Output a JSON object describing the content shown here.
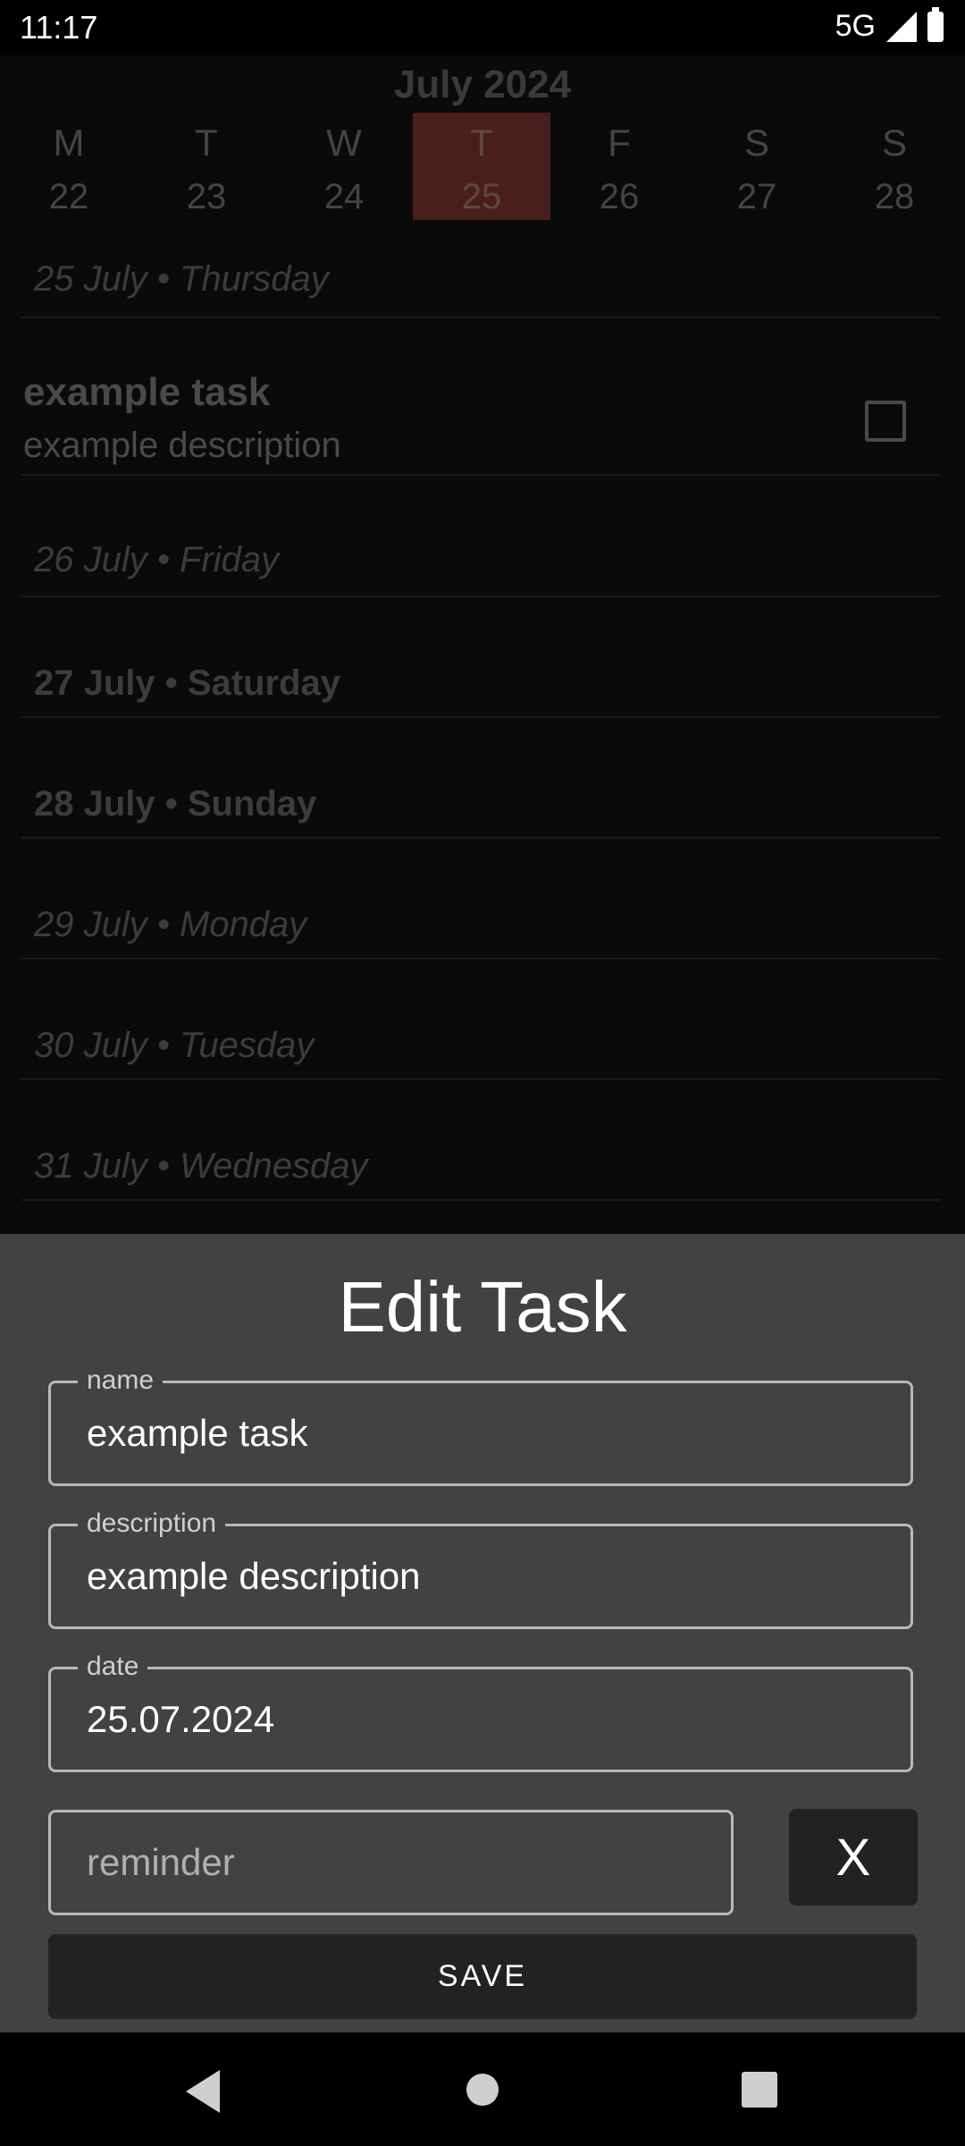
{
  "status_bar": {
    "time": "11:17",
    "network": "5G"
  },
  "calendar": {
    "month": "July 2024",
    "days": [
      {
        "name": "M",
        "num": "22"
      },
      {
        "name": "T",
        "num": "23"
      },
      {
        "name": "W",
        "num": "24"
      },
      {
        "name": "T",
        "num": "25"
      },
      {
        "name": "F",
        "num": "26"
      },
      {
        "name": "S",
        "num": "27"
      },
      {
        "name": "S",
        "num": "28"
      }
    ],
    "selected_index": 3,
    "selected_color": "#4a1f1b"
  },
  "sections": [
    {
      "header": "25 July • Thursday"
    },
    {
      "header": "26 July • Friday"
    },
    {
      "header": "27 July • Saturday"
    },
    {
      "header": "28 July • Sunday"
    },
    {
      "header": "29 July • Monday"
    },
    {
      "header": "30 July • Tuesday"
    },
    {
      "header": "31 July • Wednesday"
    }
  ],
  "task": {
    "name": "example task",
    "description": "example description",
    "checked": false
  },
  "edit_sheet": {
    "title": "Edit Task",
    "name_label": "name",
    "name_value": "example task",
    "description_label": "description",
    "description_value": "example description",
    "date_label": "date",
    "date_value": "25.07.2024",
    "reminder_placeholder": "reminder",
    "clear_label": "X",
    "save_label": "SAVE"
  }
}
